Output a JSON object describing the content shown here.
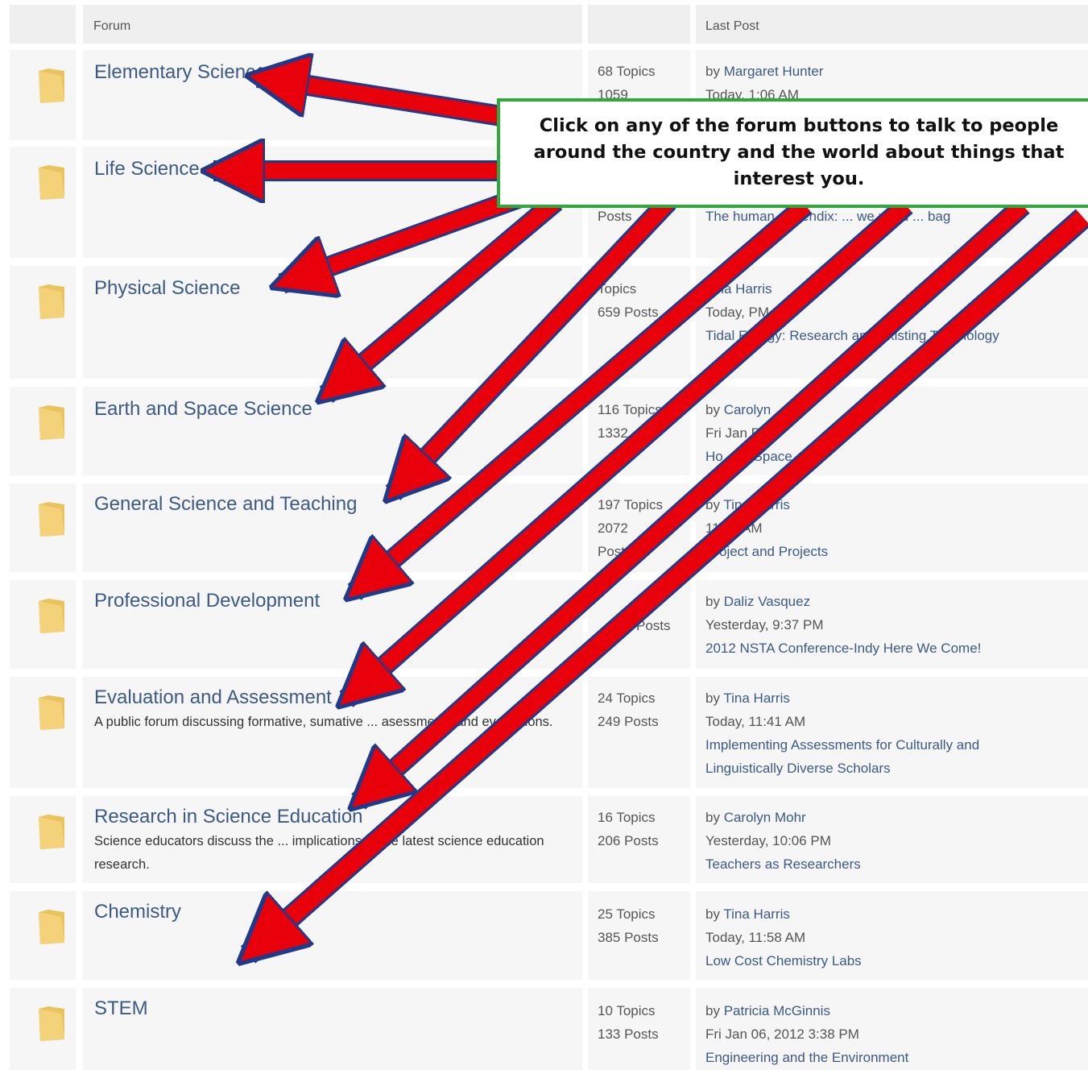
{
  "header": {
    "forum_col": "Forum",
    "last_post_col": "Last Post"
  },
  "callout": {
    "text": "Click on any of the forum buttons to talk to people around the country and the world about things that interest you."
  },
  "accent_colors": {
    "arrow": "#e8000b",
    "arrow_outline": "#1f3a8a",
    "callout_border": "#2eaa3a",
    "link": "#3b5a8a"
  },
  "forums": [
    {
      "icon": "folder-icon",
      "title": "Elementary Science",
      "description": "",
      "topics": "68 Topics",
      "posts": "1059",
      "last_by": "by ",
      "last_author": "Margaret Hunter",
      "last_time": "Today, 1:06 AM",
      "last_topic": ""
    },
    {
      "icon": "folder-icon",
      "title": "Life Science",
      "description": "",
      "topics": "",
      "posts": "Posts",
      "last_by": "",
      "last_author": "",
      "last_time": "",
      "last_topic": "The human appendix: ... we need ... bag"
    },
    {
      "icon": "folder-icon",
      "title": "Physical Science",
      "description": "",
      "topics": "Topics",
      "posts": "659 Posts",
      "last_by": "",
      "last_author": "Tina Harris",
      "last_time": "Today, PM",
      "last_topic": "Tidal Energy: Research and Existing Technology"
    },
    {
      "icon": "folder-icon",
      "title": "Earth and Space Science",
      "description": "",
      "topics": "116 Topics",
      "posts": "1332",
      "last_by": "by ",
      "last_author": "Carolyn",
      "last_time": "Fri Jan PM",
      "last_topic": "Ho... In Space"
    },
    {
      "icon": "folder-icon",
      "title": "General Science and Teaching",
      "description": "",
      "topics": "197 Topics",
      "posts": "2072",
      "posts2": "Posts",
      "last_by": "by ",
      "last_author": "Tina Harris",
      "last_time": "11:07 AM",
      "last_topic": "Project and Projects"
    },
    {
      "icon": "folder-icon",
      "title": "Professional Development",
      "description": "",
      "topics": "",
      "posts": "Posts",
      "last_by": "by ",
      "last_author": "Daliz Vasquez",
      "last_time": "Yesterday, 9:37 PM",
      "last_topic": "2012 NSTA Conference-Indy Here We Come!"
    },
    {
      "icon": "folder-icon",
      "title": "Evaluation and Assessment",
      "description": "A public forum discussing formative, sumative ... asessments and evaluations.",
      "topics": "24 Topics",
      "posts": "249 Posts",
      "last_by": "by ",
      "last_author": "Tina Harris",
      "last_time": "Today, 11:41 AM",
      "last_topic": "Implementing Assessments for Culturally and Linguistically Diverse Scholars"
    },
    {
      "icon": "folder-icon",
      "title": "Research in Science Education",
      "description": "Science educators discuss the ... implications of the latest science education research.",
      "topics": "16 Topics",
      "posts": "206 Posts",
      "last_by": "by ",
      "last_author": "Carolyn Mohr",
      "last_time": "Yesterday, 10:06 PM",
      "last_topic": "Teachers as Researchers"
    },
    {
      "icon": "folder-icon",
      "title": "Chemistry",
      "description": "",
      "topics": "25 Topics",
      "posts": "385 Posts",
      "last_by": "by ",
      "last_author": "Tina Harris",
      "last_time": "Today, 11:58 AM",
      "last_topic": "Low Cost Chemistry Labs"
    },
    {
      "icon": "folder-icon",
      "title": "STEM",
      "description": "",
      "topics": "10 Topics",
      "posts": "133 Posts",
      "last_by": "by ",
      "last_author": "Patricia McGinnis",
      "last_time": "Fri Jan 06, 2012 3:38 PM",
      "last_topic": "Engineering and the Environment"
    }
  ]
}
